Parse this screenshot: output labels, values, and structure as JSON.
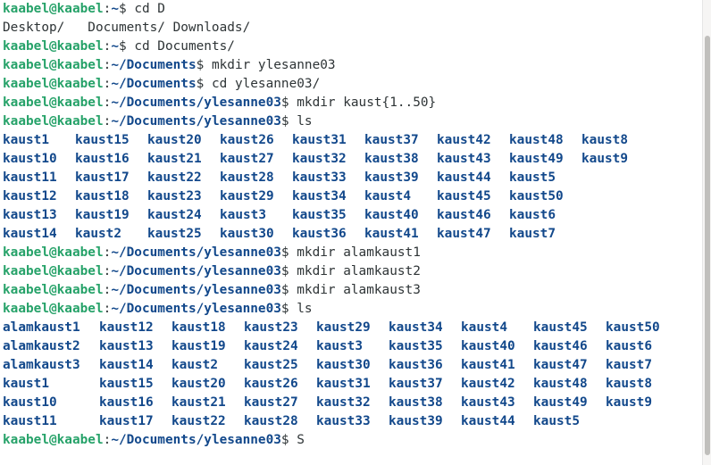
{
  "lines": [
    {
      "kind": "prompt",
      "user": "kaabel@kaabel",
      "path": "~",
      "cmd": "cd D"
    },
    {
      "kind": "out",
      "text": "Desktop/   Documents/ Downloads/"
    },
    {
      "kind": "prompt",
      "user": "kaabel@kaabel",
      "path": "~",
      "cmd": "cd Documents/"
    },
    {
      "kind": "prompt",
      "user": "kaabel@kaabel",
      "path": "~/Documents",
      "cmd": "mkdir ylesanne03"
    },
    {
      "kind": "prompt",
      "user": "kaabel@kaabel",
      "path": "~/Documents",
      "cmd": "cd ylesanne03/"
    },
    {
      "kind": "prompt",
      "user": "kaabel@kaabel",
      "path": "~/Documents/ylesanne03",
      "cmd": "mkdir kaust{1..50}"
    },
    {
      "kind": "prompt",
      "user": "kaabel@kaabel",
      "path": "~/Documents/ylesanne03",
      "cmd": "ls"
    },
    {
      "kind": "dirs",
      "items": [
        "kaust1",
        "kaust15",
        "kaust20",
        "kaust26",
        "kaust31",
        "kaust37",
        "kaust42",
        "kaust48",
        "kaust8"
      ]
    },
    {
      "kind": "dirs",
      "items": [
        "kaust10",
        "kaust16",
        "kaust21",
        "kaust27",
        "kaust32",
        "kaust38",
        "kaust43",
        "kaust49",
        "kaust9"
      ]
    },
    {
      "kind": "dirs",
      "items": [
        "kaust11",
        "kaust17",
        "kaust22",
        "kaust28",
        "kaust33",
        "kaust39",
        "kaust44",
        "kaust5"
      ]
    },
    {
      "kind": "dirs",
      "items": [
        "kaust12",
        "kaust18",
        "kaust23",
        "kaust29",
        "kaust34",
        "kaust4",
        "kaust45",
        "kaust50"
      ]
    },
    {
      "kind": "dirs",
      "items": [
        "kaust13",
        "kaust19",
        "kaust24",
        "kaust3",
        "kaust35",
        "kaust40",
        "kaust46",
        "kaust6"
      ]
    },
    {
      "kind": "dirs",
      "items": [
        "kaust14",
        "kaust2",
        "kaust25",
        "kaust30",
        "kaust36",
        "kaust41",
        "kaust47",
        "kaust7"
      ]
    },
    {
      "kind": "prompt",
      "user": "kaabel@kaabel",
      "path": "~/Documents/ylesanne03",
      "cmd": "mkdir alamkaust1"
    },
    {
      "kind": "prompt",
      "user": "kaabel@kaabel",
      "path": "~/Documents/ylesanne03",
      "cmd": "mkdir alamkaust2"
    },
    {
      "kind": "prompt",
      "user": "kaabel@kaabel",
      "path": "~/Documents/ylesanne03",
      "cmd": "mkdir alamkaust3"
    },
    {
      "kind": "prompt",
      "user": "kaabel@kaabel",
      "path": "~/Documents/ylesanne03",
      "cmd": "ls"
    },
    {
      "kind": "dirs2",
      "items": [
        "alamkaust1",
        "kaust12",
        "kaust18",
        "kaust23",
        "kaust29",
        "kaust34",
        "kaust4",
        "kaust45",
        "kaust50"
      ]
    },
    {
      "kind": "dirs2",
      "items": [
        "alamkaust2",
        "kaust13",
        "kaust19",
        "kaust24",
        "kaust3",
        "kaust35",
        "kaust40",
        "kaust46",
        "kaust6"
      ]
    },
    {
      "kind": "dirs2",
      "items": [
        "alamkaust3",
        "kaust14",
        "kaust2",
        "kaust25",
        "kaust30",
        "kaust36",
        "kaust41",
        "kaust47",
        "kaust7"
      ]
    },
    {
      "kind": "dirs2",
      "items": [
        "kaust1",
        "kaust15",
        "kaust20",
        "kaust26",
        "kaust31",
        "kaust37",
        "kaust42",
        "kaust48",
        "kaust8"
      ]
    },
    {
      "kind": "dirs2",
      "items": [
        "kaust10",
        "kaust16",
        "kaust21",
        "kaust27",
        "kaust32",
        "kaust38",
        "kaust43",
        "kaust49",
        "kaust9"
      ]
    },
    {
      "kind": "dirs2",
      "items": [
        "kaust11",
        "kaust17",
        "kaust22",
        "kaust28",
        "kaust33",
        "kaust39",
        "kaust44",
        "kaust5"
      ]
    },
    {
      "kind": "prompt",
      "user": "kaabel@kaabel",
      "path": "~/Documents/ylesanne03",
      "cmd": "S"
    }
  ],
  "colors": {
    "user": "#26a269",
    "path": "#12488b",
    "directory": "#12488b",
    "text": "#2e3436",
    "background": "#ffffff"
  }
}
